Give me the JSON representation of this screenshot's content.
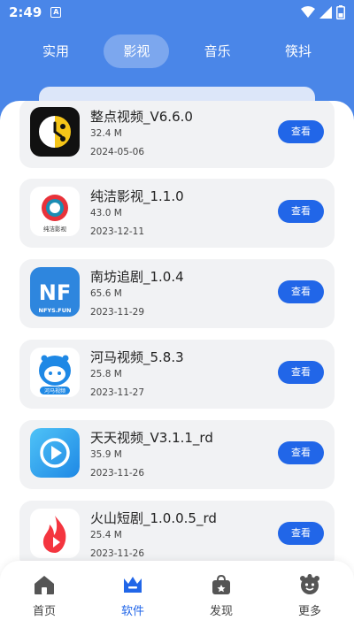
{
  "status_bar": {
    "time": "2:49",
    "badge": "A"
  },
  "top_tabs": [
    {
      "label": "实用",
      "active": false
    },
    {
      "label": "影视",
      "active": true
    },
    {
      "label": "音乐",
      "active": false
    },
    {
      "label": "筷抖",
      "active": false
    }
  ],
  "apps": [
    {
      "name": "整点视频_V6.6.0",
      "size": "32.4 M",
      "date": "2024-05-06",
      "button": "查看",
      "icon": "clock-video-icon"
    },
    {
      "name": "纯洁影视_1.1.0",
      "size": "43.0 M",
      "date": "2023-12-11",
      "button": "查看",
      "icon": "chunjie-icon",
      "icon_caption": "纯洁影视"
    },
    {
      "name": "南坊追剧_1.0.4",
      "size": "65.6 M",
      "date": "2023-11-29",
      "button": "查看",
      "icon": "nf-icon",
      "icon_text": "NF",
      "icon_caption": "NFYS.FUN"
    },
    {
      "name": "河马视频_5.8.3",
      "size": "25.8 M",
      "date": "2023-11-27",
      "button": "查看",
      "icon": "hippo-icon",
      "icon_caption": "河马视频"
    },
    {
      "name": "天天视频_V3.1.1_rd",
      "size": "35.9 M",
      "date": "2023-11-26",
      "button": "查看",
      "icon": "play-icon"
    },
    {
      "name": "火山短剧_1.0.0.5_rd",
      "size": "25.4 M",
      "date": "2023-11-26",
      "button": "查看",
      "icon": "flame-icon"
    }
  ],
  "bottom_nav": [
    {
      "label": "首页",
      "icon": "home-icon",
      "active": false
    },
    {
      "label": "软件",
      "icon": "crown-icon",
      "active": true
    },
    {
      "label": "发现",
      "icon": "bag-icon",
      "active": false
    },
    {
      "label": "更多",
      "icon": "more-face-icon",
      "active": false
    }
  ],
  "colors": {
    "header_blue": "#4a86e8",
    "button_blue": "#2166e8",
    "card_bg": "#f1f2f4"
  }
}
